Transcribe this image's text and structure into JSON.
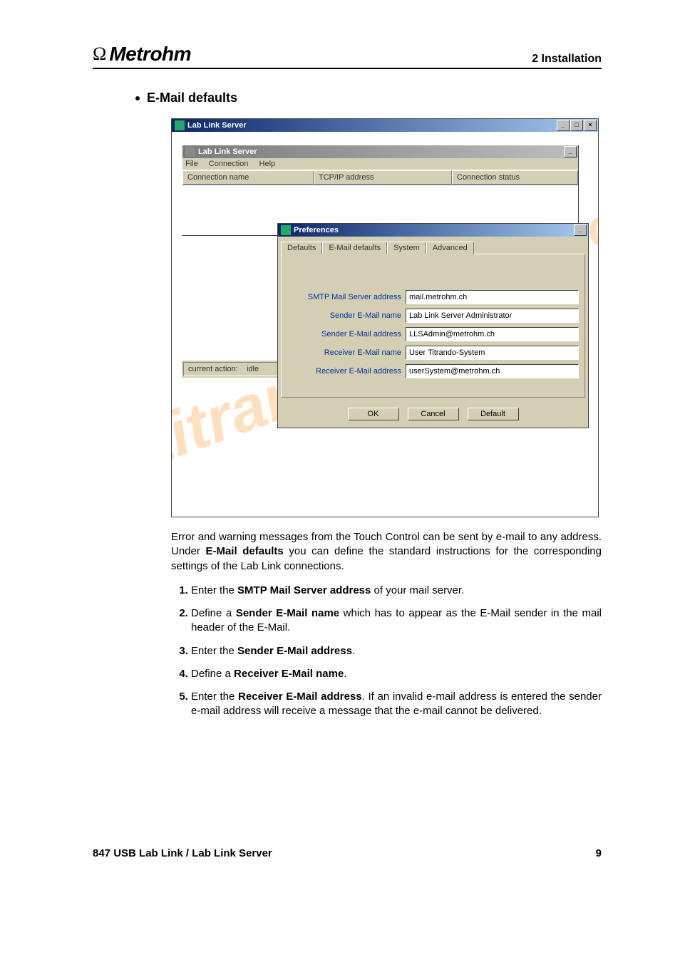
{
  "header": {
    "brand": "Metrohm",
    "section": "2 Installation"
  },
  "section_title": "E-Mail defaults",
  "outer_window": {
    "title": "Lab Link Server"
  },
  "inner_window": {
    "title": "Lab Link Server",
    "menu": {
      "file": "File",
      "connection": "Connection",
      "help": "Help"
    },
    "columns": {
      "c1": "Connection name",
      "c2": "TCP/IP address",
      "c3": "Connection status"
    },
    "status_label": "current action:",
    "status_value": "idle"
  },
  "prefs": {
    "title": "Preferences",
    "tabs": {
      "defaults": "Defaults",
      "email": "E-Mail defaults",
      "system": "System",
      "advanced": "Advanced"
    },
    "fields": {
      "smtp": {
        "label": "SMTP Mail Server address",
        "value": "mail.metrohm.ch"
      },
      "sender_name": {
        "label": "Sender E-Mail name",
        "value": "Lab Link Server Administrator"
      },
      "sender_addr": {
        "label": "Sender E-Mail address",
        "value": "LLSAdmin@metrohm.ch"
      },
      "recv_name": {
        "label": "Receiver E-Mail name",
        "value": "User Titrando-System"
      },
      "recv_addr": {
        "label": "Receiver E-Mail address",
        "value": "userSystem@metrohm.ch"
      }
    },
    "buttons": {
      "ok": "OK",
      "cancel": "Cancel",
      "default": "Default"
    }
  },
  "paragraph": {
    "p1a": "Error and warning messages from the Touch Control can be sent by e-mail to any address. Under ",
    "p1b": "E-Mail defaults",
    "p1c": " you can define the standard instructions for the corresponding settings of the Lab Link connections."
  },
  "steps": {
    "s1a": "Enter the ",
    "s1b": "SMTP Mail Server address",
    "s1c": " of your mail server.",
    "s2a": "Define a ",
    "s2b": "Sender E-Mail name",
    "s2c": " which has to appear as the E-Mail sender in the mail header of the E-Mail.",
    "s3a": "Enter the ",
    "s3b": "Sender E-Mail address",
    "s3c": ".",
    "s4a": "Define a ",
    "s4b": "Receiver E-Mail name",
    "s4c": ".",
    "s5a": "Enter the ",
    "s5b": "Receiver E-Mail address",
    "s5c": ". If an invalid e-mail address is entered the sender e-mail address will receive a message that the e-mail cannot be delivered."
  },
  "footer": {
    "left": "847 USB Lab Link / Lab Link Server",
    "right": "9"
  }
}
